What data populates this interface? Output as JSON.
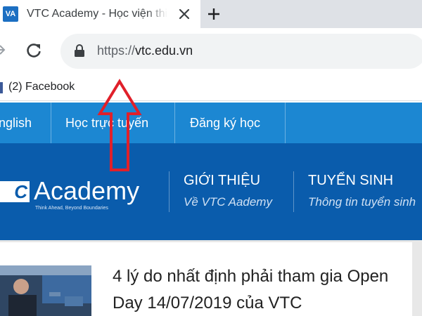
{
  "browser": {
    "tab": {
      "favicon_text": "VA",
      "title": "VTC Academy - Học viện thiết kế",
      "close_icon": "close-icon"
    },
    "new_tab_icon": "plus-icon",
    "toolbar": {
      "back_icon": "back-arrow-icon",
      "reload_icon": "reload-icon",
      "lock_icon": "lock-icon",
      "url_scheme": "https://",
      "url_host": "vtc.edu.vn"
    },
    "bookmarks": [
      {
        "label": "(2) Facebook"
      }
    ]
  },
  "site": {
    "topnav": [
      {
        "label": "nglish"
      },
      {
        "label": "Học trực tuyến"
      },
      {
        "label": "Đăng ký học"
      }
    ],
    "logo": {
      "box_text": "C",
      "text": "Academy",
      "tagline": "Think Ahead, Beyond Boundaries"
    },
    "menu": [
      {
        "title": "GIỚI THIỆU",
        "subtitle": "Về VTC Aademy"
      },
      {
        "title": "TUYỂN SINH",
        "subtitle": "Thông tin tuyển sinh"
      }
    ],
    "article": {
      "title": "4 lý do nhất định phải tham gia Open Day 14/07/2019 của VTC"
    }
  },
  "colors": {
    "topnav": "#1c87d2",
    "header": "#0a5cac",
    "annotation_arrow": "#e0202a"
  }
}
